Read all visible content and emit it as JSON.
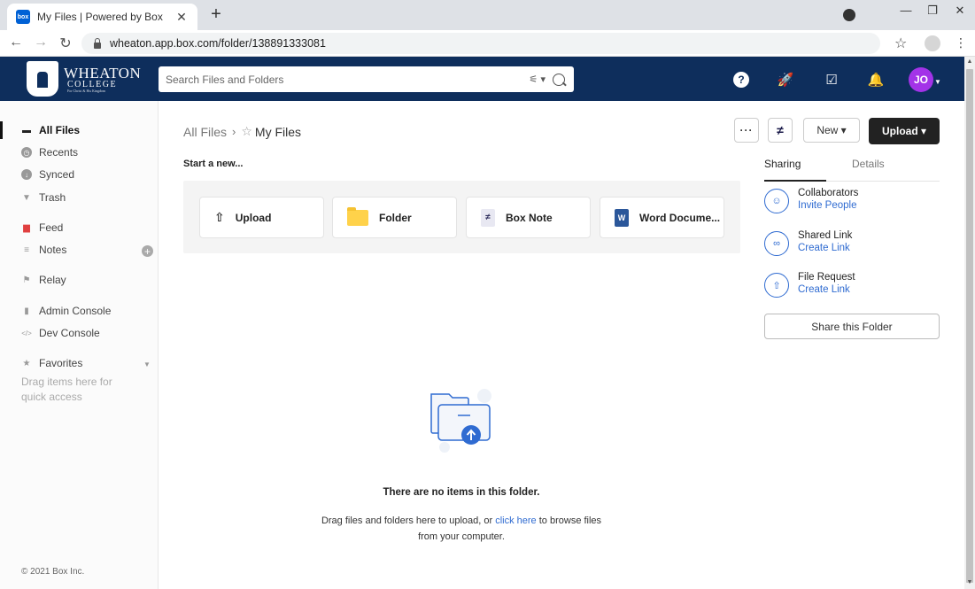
{
  "browser": {
    "tab_title": "My Files | Powered by Box",
    "favicon_text": "box",
    "url": "wheaton.app.box.com/folder/138891333081"
  },
  "header": {
    "logo_line1": "WHEATON",
    "logo_line2": "COLLEGE",
    "logo_line3": "For Christ & His Kingdom",
    "search_placeholder": "Search Files and Folders",
    "avatar_initials": "JO",
    "colors": {
      "header_bg": "#0e2e5c",
      "avatar_bg": "#a333e8"
    }
  },
  "sidebar": {
    "items": [
      {
        "label": "All Files",
        "icon": "folder-icon",
        "active": true
      },
      {
        "label": "Recents",
        "icon": "clock-icon"
      },
      {
        "label": "Synced",
        "icon": "synced-icon"
      },
      {
        "label": "Trash",
        "icon": "trash-icon"
      },
      {
        "label": "Feed",
        "icon": "feed-icon"
      },
      {
        "label": "Notes",
        "icon": "notes-icon"
      },
      {
        "label": "Relay",
        "icon": "relay-icon"
      },
      {
        "label": "Admin Console",
        "icon": "chart-icon"
      },
      {
        "label": "Dev Console",
        "icon": "code-icon"
      },
      {
        "label": "Favorites",
        "icon": "star-icon"
      }
    ],
    "favorites_hint": "Drag items here for quick access",
    "copyright": "© 2021 Box Inc."
  },
  "main": {
    "breadcrumb_root": "All Files",
    "breadcrumb_current": "My Files",
    "start_new_label": "Start a new...",
    "new_cards": [
      {
        "label": "Upload",
        "icon": "upload-icon"
      },
      {
        "label": "Folder",
        "icon": "folder-icon"
      },
      {
        "label": "Box Note",
        "icon": "box-note-icon"
      },
      {
        "label": "Word Docume...",
        "icon": "word-icon"
      }
    ],
    "toolbar": {
      "more_label": "···",
      "new_label": "New ▾",
      "upload_label": "Upload ▾"
    },
    "empty": {
      "title": "There are no items in this folder.",
      "desc_before": "Drag files and folders here to upload, or ",
      "desc_link": "click here",
      "desc_after": " to browse files from your computer."
    }
  },
  "right_panel": {
    "tabs": [
      "Sharing",
      "Details"
    ],
    "rows": [
      {
        "title": "Collaborators",
        "link": "Invite People",
        "icon": "collaborator-icon"
      },
      {
        "title": "Shared Link",
        "link": "Create Link",
        "icon": "link-icon"
      },
      {
        "title": "File Request",
        "link": "Create Link",
        "icon": "upload-cloud-icon"
      }
    ],
    "share_button": "Share this Folder"
  }
}
